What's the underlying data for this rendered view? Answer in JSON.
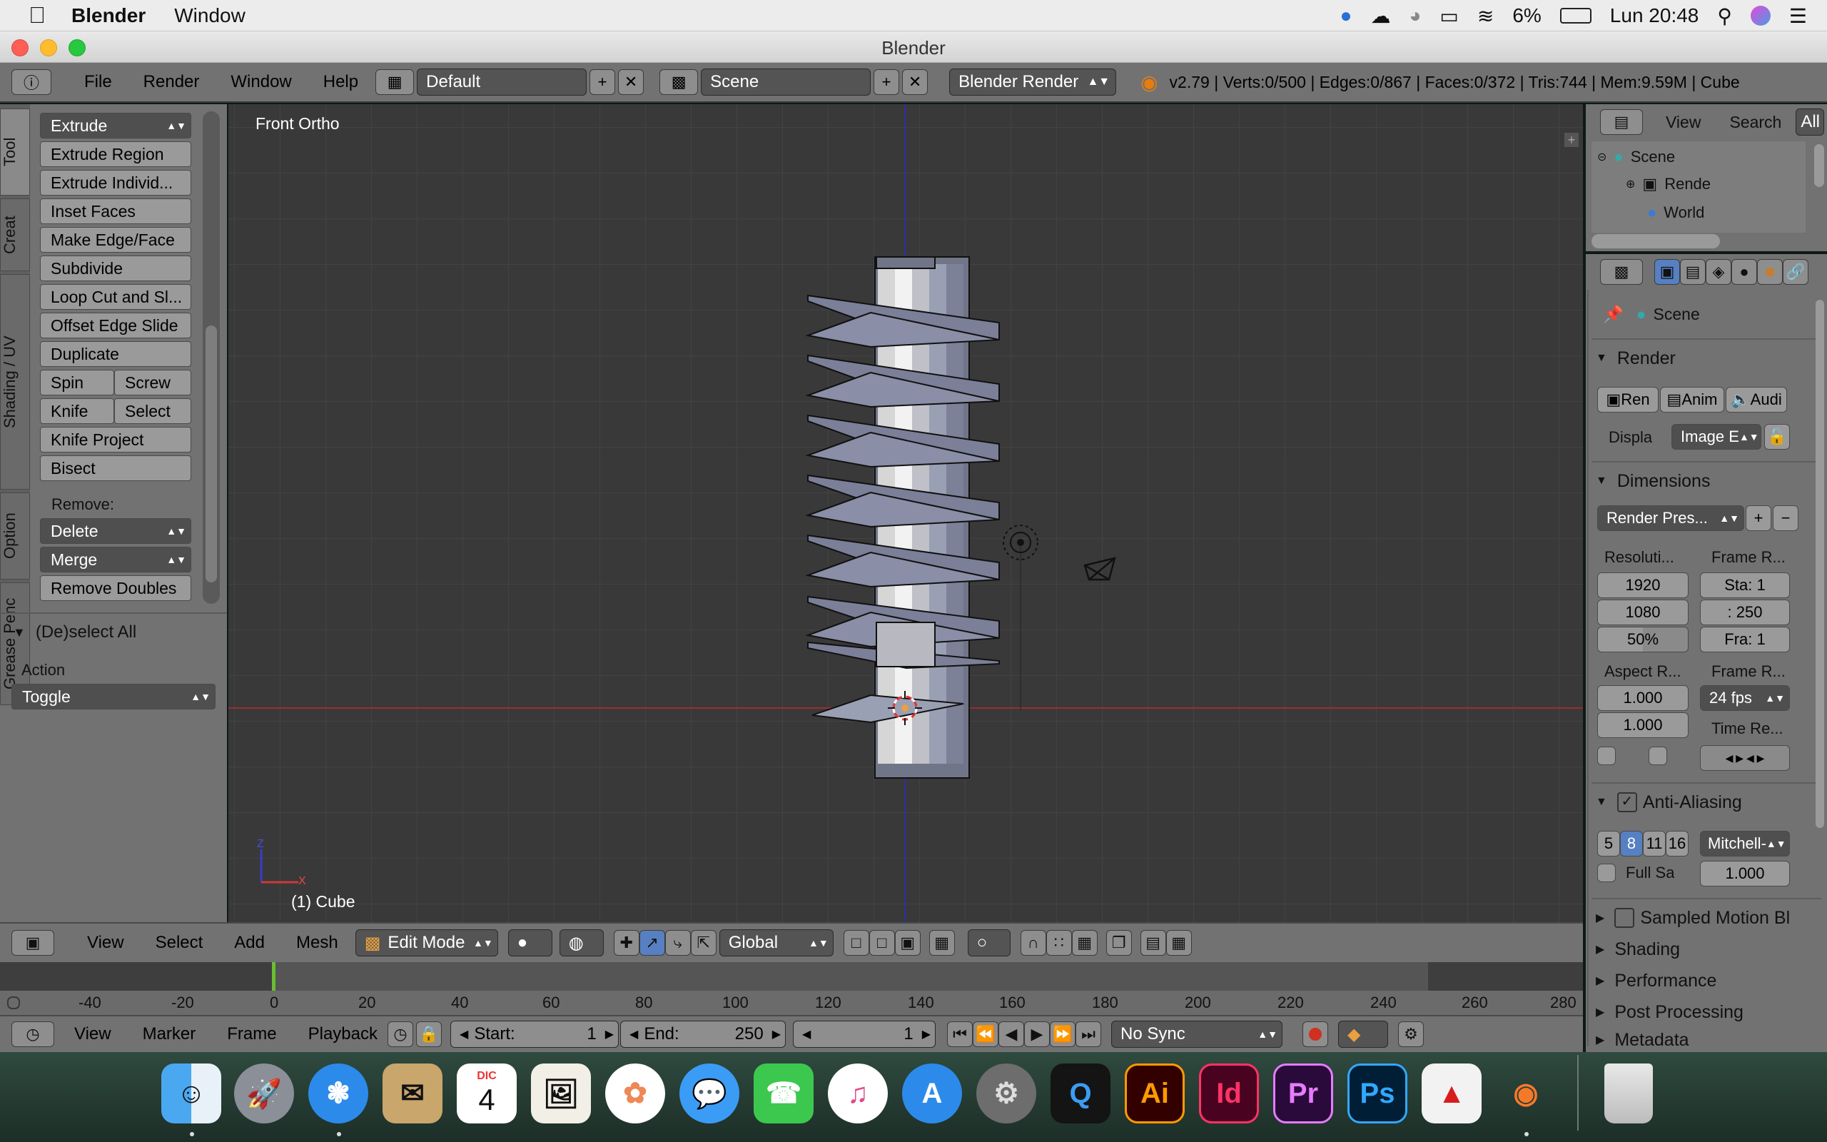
{
  "menubar": {
    "app": "Blender",
    "menu_window": "Window",
    "battery": "6%",
    "clock": "Lun 20:48"
  },
  "window": {
    "title": "Blender"
  },
  "info": {
    "menus": [
      "File",
      "Render",
      "Window",
      "Help"
    ],
    "layout": "Default",
    "scene": "Scene",
    "engine": "Blender Render",
    "stats": "v2.79 | Verts:0/500 | Edges:0/867 | Faces:0/372 | Tris:744 | Mem:9.59M | Cube"
  },
  "toolshelf": {
    "tabs": [
      "Tool",
      "Creat",
      "Shading / UV",
      "Option",
      "Grease Penc"
    ],
    "extrude": "Extrude",
    "extrude_region": "Extrude Region",
    "extrude_individual": "Extrude Individ...",
    "inset_faces": "Inset Faces",
    "make_edge_face": "Make Edge/Face",
    "subdivide": "Subdivide",
    "loop_cut": "Loop Cut and Sl...",
    "offset_edge_slide": "Offset Edge Slide",
    "duplicate": "Duplicate",
    "spin": "Spin",
    "screw": "Screw",
    "knife": "Knife",
    "select": "Select",
    "knife_project": "Knife Project",
    "bisect": "Bisect",
    "remove_label": "Remove:",
    "delete": "Delete",
    "merge": "Merge",
    "remove_doubles": "Remove Doubles",
    "operator_panel": "(De)select All",
    "action_label": "Action",
    "action_value": "Toggle"
  },
  "viewport": {
    "view_name": "Front Ortho",
    "object_info": "(1) Cube",
    "axis_z": "Z",
    "axis_x": "X"
  },
  "view3d_header": {
    "menus": [
      "View",
      "Select",
      "Add",
      "Mesh"
    ],
    "mode": "Edit Mode",
    "orientation": "Global"
  },
  "timeline": {
    "ticks": [
      "-40",
      "-20",
      "0",
      "20",
      "40",
      "60",
      "80",
      "100",
      "120",
      "140",
      "160",
      "180",
      "200",
      "220",
      "240",
      "260",
      "280"
    ],
    "menus": [
      "View",
      "Marker",
      "Frame",
      "Playback"
    ],
    "start_label": "Start:",
    "start_value": "1",
    "end_label": "End:",
    "end_value": "250",
    "current_frame": "1",
    "sync": "No Sync"
  },
  "outliner": {
    "view": "View",
    "search": "Search",
    "all": "All",
    "items": [
      "Scene",
      "Rende",
      "World"
    ]
  },
  "properties": {
    "context": "Scene",
    "render_panel": "Render",
    "render_btn": "Ren",
    "anim_btn": "Anim",
    "audio_btn": "Audi",
    "display_label": "Displa",
    "display_value": "Image E",
    "dimensions_panel": "Dimensions",
    "presets": "Render Pres...",
    "resolution_label": "Resoluti...",
    "frame_range_label": "Frame R...",
    "res_x": "1920",
    "res_y": "1080",
    "res_pct": "50%",
    "start": "Sta: 1",
    "end": ":  250",
    "step": "Fra: 1",
    "aspect_label": "Aspect R...",
    "frame_rate_label": "Frame R...",
    "aspect_x": "1.000",
    "aspect_y": "1.000",
    "fps": "24 fps",
    "time_remap_label": "Time Re...",
    "aa_panel": "Anti-Aliasing",
    "aa_samples": [
      "5",
      "8",
      "11",
      "16"
    ],
    "aa_filter": "Mitchell-",
    "full_sample": "Full Sa",
    "filter_size": "1.000",
    "sampled_motion": "Sampled Motion Bl",
    "shading": "Shading",
    "performance": "Performance",
    "post_processing": "Post Processing",
    "metadata": "Metadata"
  },
  "dock": {
    "calendar_month": "DIC",
    "calendar_day": "4",
    "illustrator": "Ai",
    "indesign": "Id",
    "premiere": "Pr",
    "photoshop": "Ps"
  }
}
